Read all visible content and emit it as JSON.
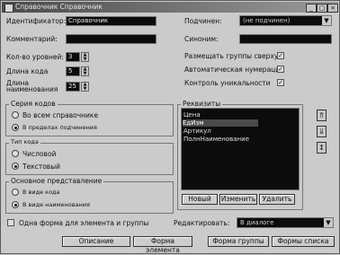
{
  "window": {
    "title": "Справочник Справочник",
    "minimize": "_",
    "maximize": "□",
    "close": "×"
  },
  "fields": {
    "identifier_label": "Идентификатор:",
    "identifier_value": "Справочник",
    "comment_label": "Комментарий:",
    "comment_value": "",
    "levels_label": "Кол-во уровней:",
    "levels_value": "3",
    "code_length_label": "Длина кода",
    "code_length_value": "5",
    "name_length_label": "Длина наименования",
    "name_length_value": "25",
    "subordinate_label": "Подчинен:",
    "subordinate_value": "(не подчинен)",
    "synonym_label": "Синоним:",
    "synonym_value": ""
  },
  "checks": [
    {
      "label": "Размещать группы сверху",
      "checked": true
    },
    {
      "label": "Автоматическая нумерация",
      "checked": true
    },
    {
      "label": "Контроль уникальности",
      "checked": true
    }
  ],
  "code_series": {
    "title": "Серия кодов",
    "options": [
      {
        "label": "Во всем справочнике",
        "selected": false
      },
      {
        "label": "В пределах подчинения",
        "selected": true
      }
    ]
  },
  "code_type": {
    "title": "Тип кода",
    "options": [
      {
        "label": "Числовой",
        "selected": false
      },
      {
        "label": "Текстовый",
        "selected": true
      }
    ]
  },
  "main_repr": {
    "title": "Основное представление",
    "options": [
      {
        "label": "В виде кода",
        "selected": false
      },
      {
        "label": "В виде наименования",
        "selected": true
      }
    ]
  },
  "attributes": {
    "title": "Реквизиты",
    "items": [
      "Цена",
      "ЕдИзм",
      "Артикул",
      "ПолнНаименование"
    ],
    "selected_index": 1,
    "buttons": {
      "new": "Новый",
      "edit": "Изменить",
      "delete": "Удалить"
    },
    "side": {
      "up": "⇑",
      "down": "⇓",
      "sort": "↕"
    }
  },
  "bottom": {
    "one_form_label": "Одна форма для элемента и группы",
    "edit_label": "Редактировать:",
    "edit_value": "В диалоге",
    "description_button": "Описание",
    "element_form_button": "Форма элемента",
    "group_form_button": "Форма группы",
    "list_forms_button": "Формы списка"
  }
}
